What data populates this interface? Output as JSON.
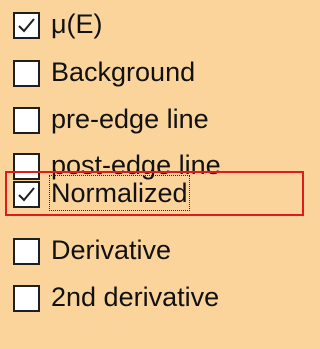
{
  "plot_options": {
    "items": [
      {
        "label": "μ(E)",
        "checked": true
      },
      {
        "label": "Background",
        "checked": false
      },
      {
        "label": "pre-edge line",
        "checked": false
      },
      {
        "label": "post-edge line",
        "checked": false
      },
      {
        "label": "Normalized",
        "checked": true
      },
      {
        "label": "Derivative",
        "checked": false
      },
      {
        "label": "2nd derivative",
        "checked": false
      }
    ]
  },
  "colors": {
    "background": "#fbd49b",
    "highlight": "#e11b1b"
  }
}
